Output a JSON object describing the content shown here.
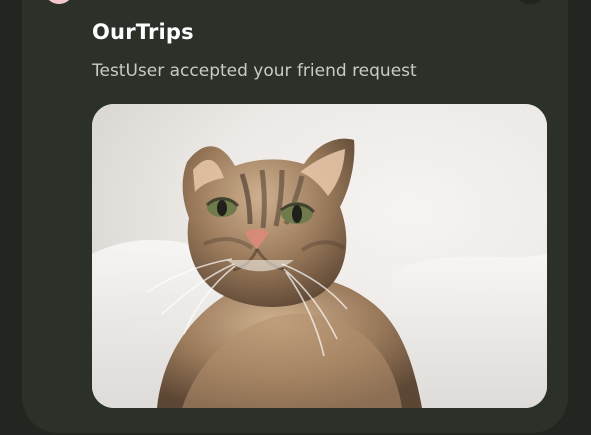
{
  "notification": {
    "title": "OurTrips",
    "message": "TestUser accepted your friend request",
    "image": {
      "icon": "cat-photo-icon"
    }
  },
  "colors": {
    "background": "#212620",
    "card": "#2b3029",
    "app_icon": "#f3c8cc"
  }
}
